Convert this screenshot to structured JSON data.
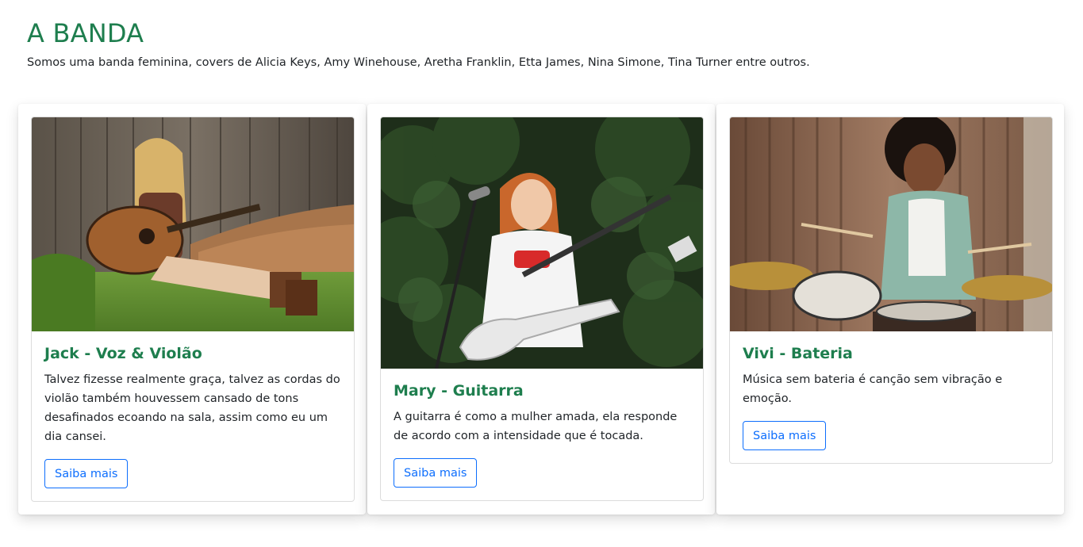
{
  "page": {
    "title": "A BANDA",
    "subtitle": "Somos uma banda feminina, covers de Alicia Keys, Amy Winehouse, Aretha Franklin, Etta James, Nina Simone, Tina Turner entre outros."
  },
  "cards": [
    {
      "title": "Jack - Voz & Violão",
      "text": "Talvez fizesse realmente graça, talvez as cordas do violão também houvessem cansado de tons desafinados ecoando na sala, assim como eu um dia cansei.",
      "button": "Saiba mais",
      "image": "photo of woman playing acoustic guitar sitting against wooden fence"
    },
    {
      "title": "Mary - Guitarra",
      "text": "A guitarra é como a mulher amada, ela responde de acordo com a intensidade que é tocada.",
      "button": "Saiba mais",
      "image": "photo of woman playing white bass guitar at microphone"
    },
    {
      "title": "Vivi - Bateria",
      "text": "Música sem bateria é canção sem vibração e emoção.",
      "button": "Saiba mais",
      "image": "photo of woman playing drum kit"
    }
  ],
  "colors": {
    "heading": "#1e7e4e",
    "button": "#0d6efd",
    "text": "#212529"
  }
}
